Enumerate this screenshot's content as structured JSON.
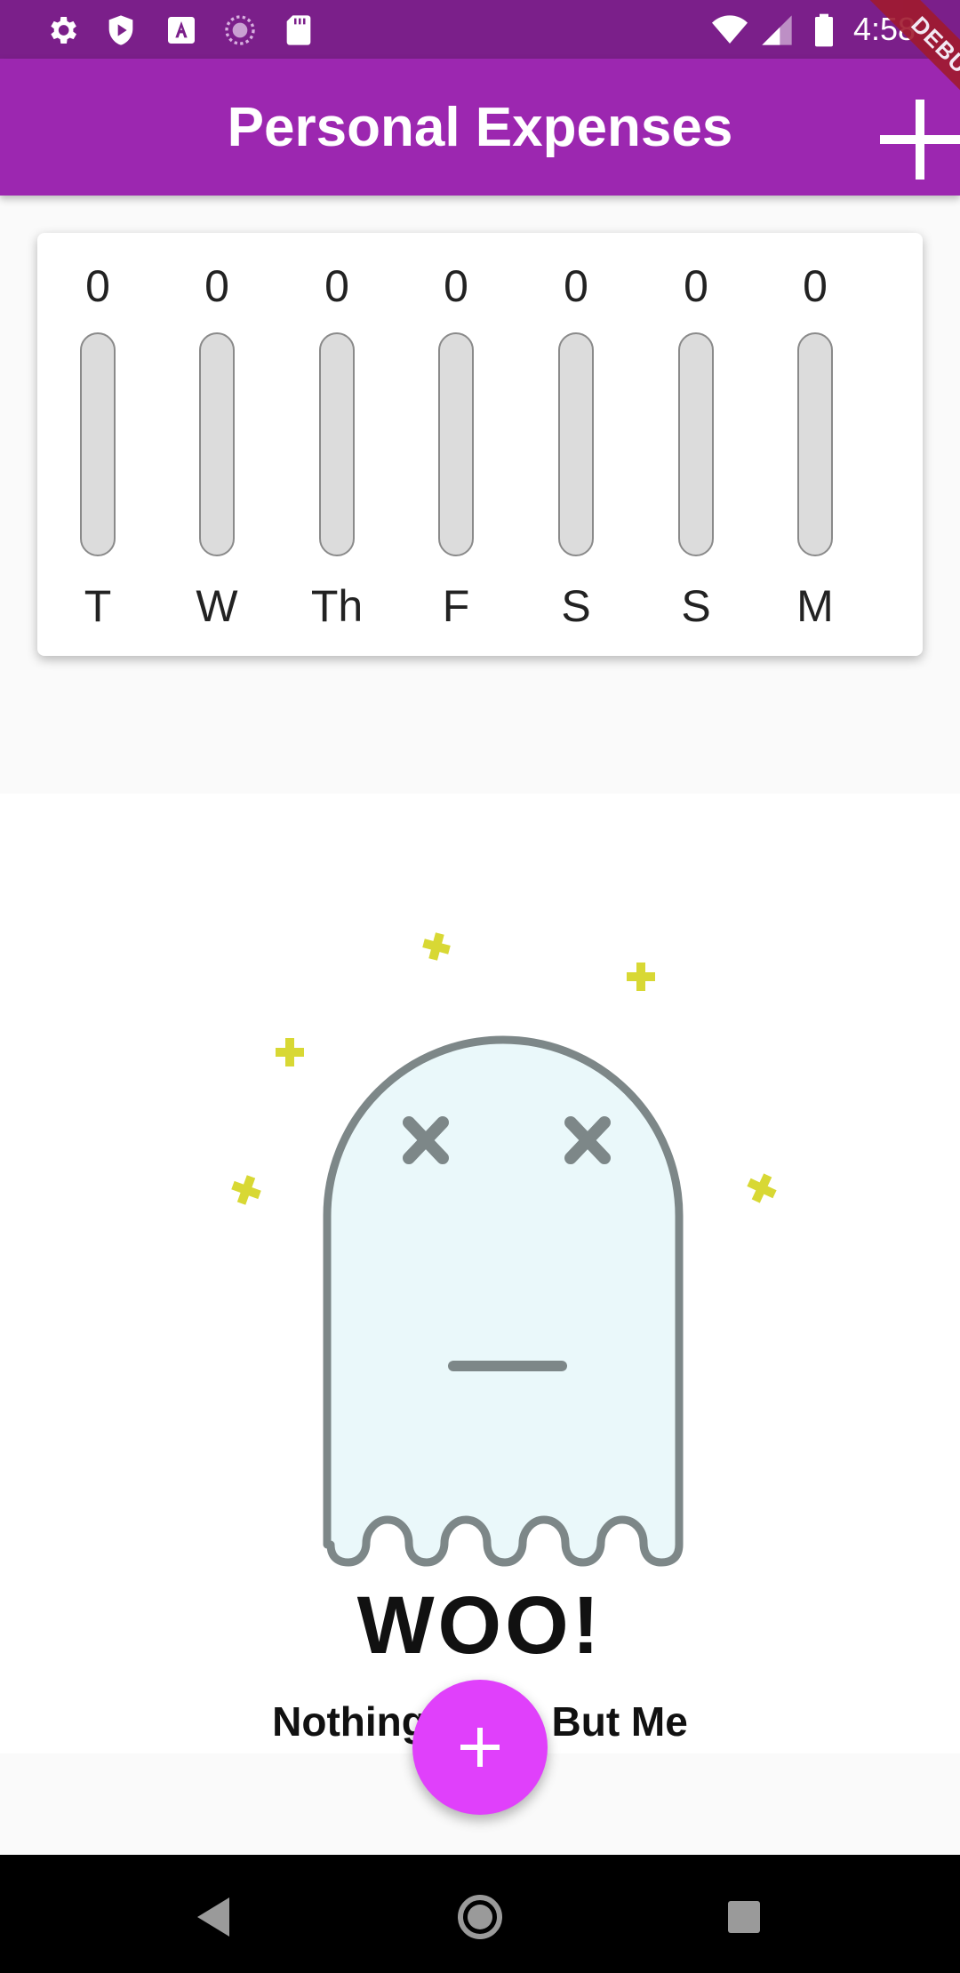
{
  "status_bar": {
    "time": "4:58",
    "left_icons": [
      "settings-icon",
      "play-protect-icon",
      "text-a-icon",
      "sync-icon",
      "sd-card-icon"
    ],
    "right_icons": [
      "wifi-icon",
      "cell-signal-icon",
      "battery-icon"
    ],
    "background": "#7b1f8a"
  },
  "app_bar": {
    "title": "Personal Expenses",
    "action_icon": "add-icon",
    "background": "#9c27b0"
  },
  "debug_banner": "DEBUG",
  "chart": {
    "bars": [
      {
        "day": "T",
        "amount": "0",
        "fill_fraction": 0
      },
      {
        "day": "W",
        "amount": "0",
        "fill_fraction": 0
      },
      {
        "day": "Th",
        "amount": "0",
        "fill_fraction": 0
      },
      {
        "day": "F",
        "amount": "0",
        "fill_fraction": 0
      },
      {
        "day": "S",
        "amount": "0",
        "fill_fraction": 0
      },
      {
        "day": "S",
        "amount": "0",
        "fill_fraction": 0
      },
      {
        "day": "M",
        "amount": "0",
        "fill_fraction": 0
      }
    ]
  },
  "empty_state": {
    "headline": "WOO!",
    "caption": "Nothing Here, But Me",
    "illustration_icon": "ghost-icon",
    "sparkle_color": "#d8d834"
  },
  "fab": {
    "icon": "add-icon",
    "color": "#e040fb"
  },
  "nav_bar": {
    "items": [
      "back-icon",
      "home-icon",
      "recents-icon"
    ]
  }
}
